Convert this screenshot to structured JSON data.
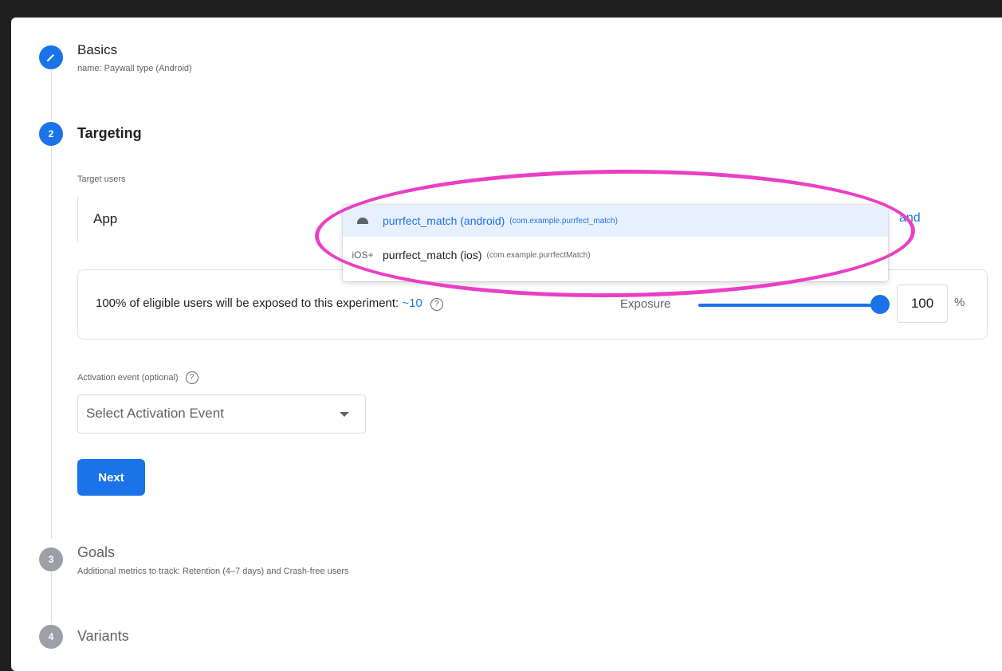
{
  "steps": [
    {
      "title": "Basics",
      "subtitle": "name: Paywall type (Android)"
    },
    {
      "number": "2",
      "title": "Targeting"
    },
    {
      "number": "3",
      "title": "Goals",
      "subtitle": "Additional metrics to track: Retention (4–7 days) and Crash-free users"
    },
    {
      "number": "4",
      "title": "Variants"
    }
  ],
  "targeting": {
    "target_users_label": "Target users",
    "app_label": "App",
    "and_link": "and",
    "exposure_text": "100% of eligible users will be exposed to this experiment:",
    "exposure_count": "~10",
    "help_glyph": "?",
    "exposure_label": "Exposure",
    "exposure_value": "100",
    "exposure_percent": 100,
    "percent_sign": "%",
    "activation_label": "Activation event (optional)",
    "activation_placeholder": "Select Activation Event",
    "next_label": "Next"
  },
  "dropdown": {
    "items": [
      {
        "icon": "android-icon",
        "name": "purrfect_match (android)",
        "package": "(com.example.purrfect_match)",
        "selected": true
      },
      {
        "icon": "ios-icon",
        "icon_text": "iOS+",
        "name": "purrfect_match (ios)",
        "package": "(com.example.purrfectMatch)",
        "selected": false
      }
    ]
  },
  "colors": {
    "accent": "#1a73e8",
    "highlight": "#ea3fc4"
  }
}
